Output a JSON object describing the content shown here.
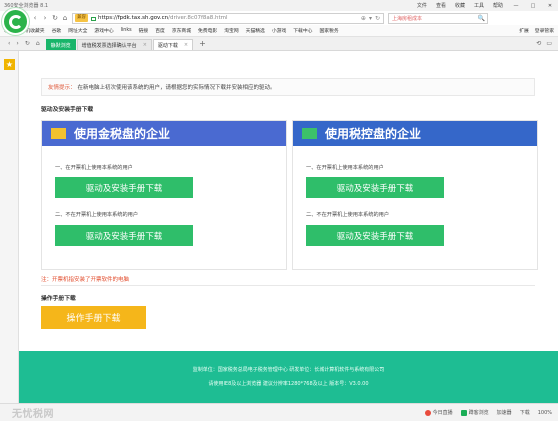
{
  "browser": {
    "app_title": "360安全浏览器 8.1",
    "menu": [
      "文件",
      "查看",
      "收藏",
      "工具",
      "帮助"
    ],
    "window_buttons": [
      "—",
      "□",
      "✕"
    ],
    "nav": {
      "mode_badge": "兼容",
      "url_scheme": "https://",
      "url_host": "fpdk.tax.sh.gov.cn",
      "url_path": "/driver.8c07f8a8.html",
      "search_text": "上海房租成本",
      "search_icon": "🔍"
    },
    "bookmarks": [
      "收藏",
      "手机收藏夹",
      "谷歌",
      "网址大全",
      "游戏中心",
      "links",
      "链接",
      "百度",
      "京东商城",
      "免费电影",
      "淘宝网",
      "天猫精选",
      "小游戏",
      "下载中心",
      "国家税务"
    ],
    "bookmarks_right": [
      "扩展",
      "登录管家"
    ],
    "tabs": [
      {
        "label": "静默浏览",
        "style": "green"
      },
      {
        "label": "增值税发票选择确认平台",
        "style": "normal"
      },
      {
        "label": "驱动下载",
        "style": "active"
      }
    ],
    "tab_add": "+"
  },
  "page": {
    "notice_label": "友情提示：",
    "notice_text": "在新电脑上初次使用该系统的用户，请根据您的实际情况下载并安装相应的驱动。",
    "section1_title": "驱动及安装手册下载",
    "card_left": {
      "title": "使用金税盘的企业",
      "text1": "一、在开票机上使用本系统的用户",
      "btn1": "驱动及安装手册下载",
      "text2": "二、不在开票机上使用本系统的用户",
      "btn2": "驱动及安装手册下载"
    },
    "card_right": {
      "title": "使用税控盘的企业",
      "text1": "一、在开票机上使用本系统的用户",
      "btn1": "驱动及安装手册下载",
      "text2": "二、不在开票机上使用本系统的用户",
      "btn2": "驱动及安装手册下载"
    },
    "note": "注：开票机指安装了开票软件的电脑",
    "section2_title": "操作手册下载",
    "manual_btn": "操作手册下载",
    "footer_line1": "监制单位：国家税务总局电子税务管理中心    研发单位：长城计算机软件与系统有限公司",
    "footer_line2": "请使用IE8及以上浏览器    建议分辨率1280*768及以上    版本号：V3.0.00"
  },
  "statusbar": {
    "watermark": "无忧税网",
    "items": [
      "今日直播",
      "蹲客浏览",
      "加速器",
      "下载",
      "100%"
    ]
  },
  "colors": {
    "brand_green": "#2bb34a",
    "card_blue": "#4a6ad1",
    "download_green": "#2fbe6a",
    "manual_orange": "#f5b61a",
    "footer_teal": "#1ebd93",
    "note_red": "#e24b2b"
  }
}
